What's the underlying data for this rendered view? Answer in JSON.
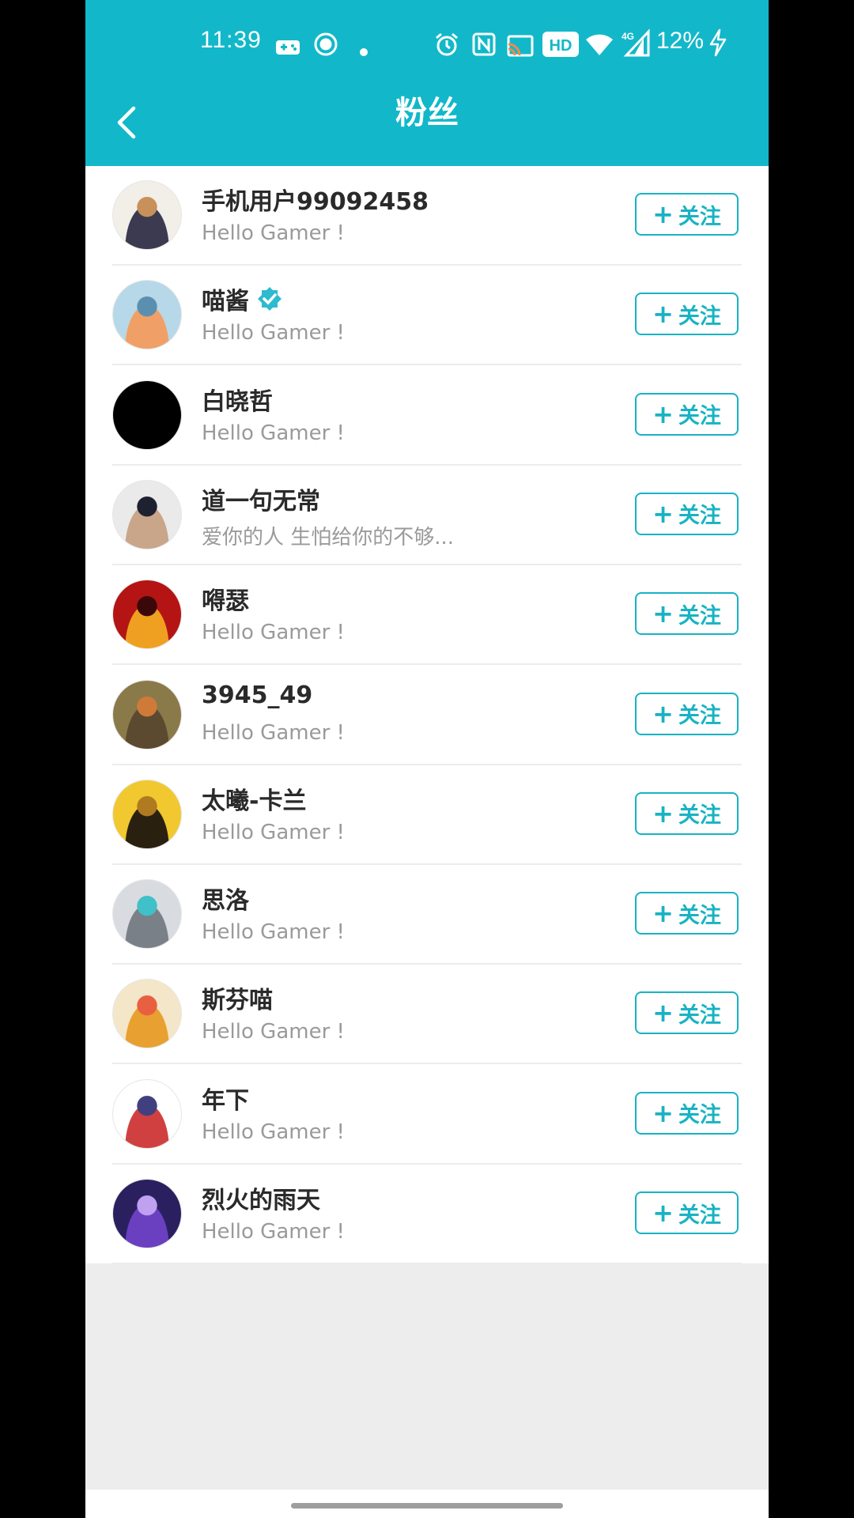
{
  "status_bar": {
    "time": "11:39",
    "battery": "12%",
    "icons": [
      "gamepad-icon",
      "record-icon",
      "dot-icon",
      "alarm-icon",
      "nfc-icon",
      "cast-icon",
      "hd-icon",
      "wifi-icon",
      "4g-signal-icon",
      "charging-icon"
    ],
    "hd_label": "HD",
    "network_label": "4G"
  },
  "header": {
    "title": "粉丝",
    "back_icon": "chevron-left-icon",
    "color": "#12b8c9"
  },
  "follow_label": "关注",
  "followers": [
    {
      "name": "手机用户99092458",
      "subtitle": "Hello Gamer !",
      "verified": false,
      "avatar_colors": [
        "#f2efe8",
        "#3b3a50",
        "#c8905a"
      ]
    },
    {
      "name": "喵酱",
      "subtitle": "Hello Gamer !",
      "verified": true,
      "avatar_colors": [
        "#b7d8e8",
        "#f0a066",
        "#5b8fb0"
      ]
    },
    {
      "name": "白晓哲",
      "subtitle": "Hello Gamer !",
      "verified": false,
      "avatar_colors": [
        "#000000",
        "#000000",
        "#000000"
      ]
    },
    {
      "name": "道一句无常",
      "subtitle": "爱你的人 生怕给你的不够...",
      "verified": false,
      "avatar_colors": [
        "#eaeaea",
        "#c9a58a",
        "#1e2230"
      ]
    },
    {
      "name": "嘚瑟",
      "subtitle": "Hello Gamer !",
      "verified": false,
      "avatar_colors": [
        "#b41414",
        "#f0a020",
        "#3a0808"
      ]
    },
    {
      "name": "3945_49",
      "subtitle": "Hello Gamer !",
      "verified": false,
      "avatar_colors": [
        "#8a7a4a",
        "#5c4a30",
        "#d07a3a"
      ]
    },
    {
      "name": "太曦-卡兰",
      "subtitle": "Hello Gamer !",
      "verified": false,
      "avatar_colors": [
        "#f2c830",
        "#2a2010",
        "#b07a20"
      ]
    },
    {
      "name": "思洛",
      "subtitle": "Hello Gamer !",
      "verified": false,
      "avatar_colors": [
        "#d8dce0",
        "#7a8088",
        "#40c0c8"
      ]
    },
    {
      "name": "斯芬喵",
      "subtitle": "Hello Gamer !",
      "verified": false,
      "avatar_colors": [
        "#f4e6c8",
        "#e8a030",
        "#e86040"
      ]
    },
    {
      "name": "年下",
      "subtitle": "Hello Gamer !",
      "verified": false,
      "avatar_colors": [
        "#ffffff",
        "#d04040",
        "#404080"
      ]
    },
    {
      "name": "烈火的雨天",
      "subtitle": "Hello Gamer !",
      "verified": false,
      "avatar_colors": [
        "#2a2060",
        "#6a40c0",
        "#c0a0f0"
      ]
    }
  ]
}
